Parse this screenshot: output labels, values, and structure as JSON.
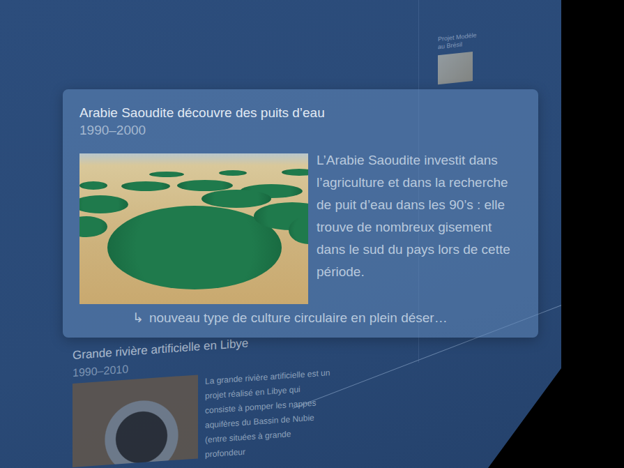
{
  "background_items": [
    {
      "title": "Projet Modèle au Brésil"
    }
  ],
  "background_card": {
    "title": "Grande rivière artificielle en Libye",
    "period": "1990–2010",
    "text": "La grande rivière artificielle est un projet réalisé en Libye qui consiste à pomper les nappes aquifères du Bassin de Nubie (entre situées à grande profondeur"
  },
  "card": {
    "title": "Arabie Saoudite découvre des puits d’eau",
    "period": "1990–2000",
    "text": "L’Arabie Saoudite investit dans l’agriculture et dans la recherche de puit d’eau dans les 90’s : elle trouve de nombreux gisement dans le sud du pays lors de cette période.",
    "note_icon": "↳",
    "note": "nouveau type de culture circulaire en plein déser…"
  }
}
